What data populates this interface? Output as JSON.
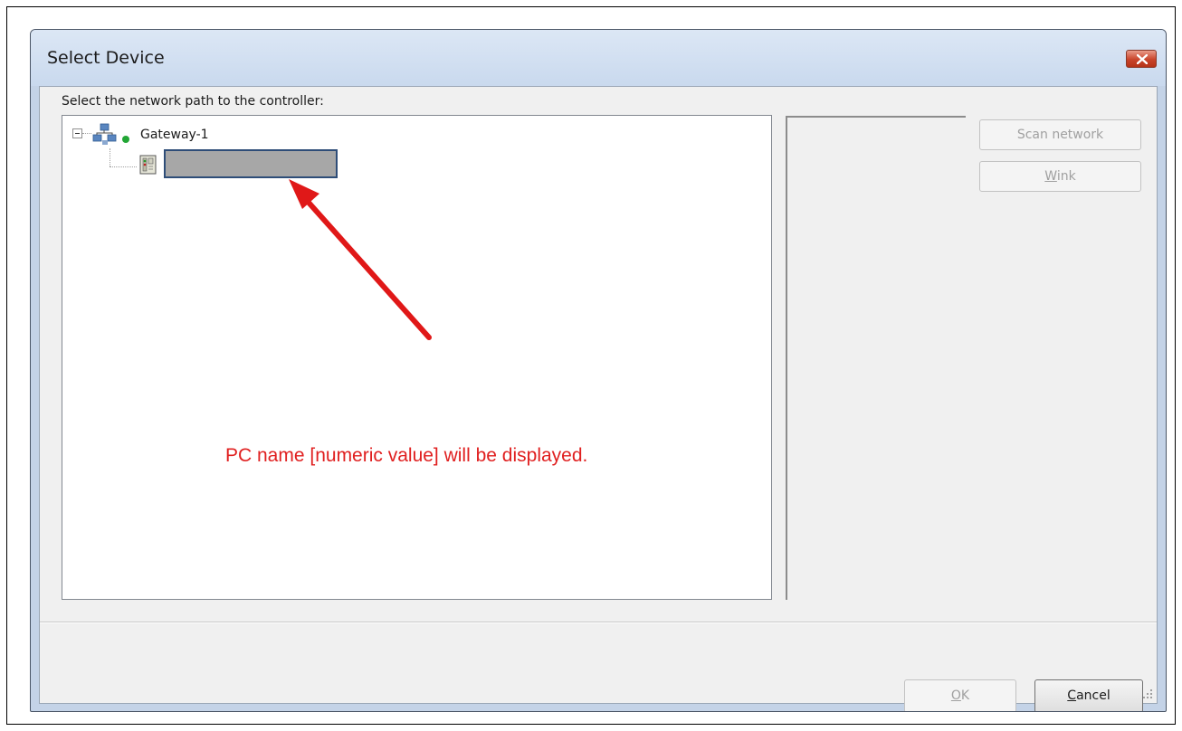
{
  "dialog": {
    "title": "Select Device",
    "prompt": "Select the network path to the controller:"
  },
  "tree": {
    "gateway": {
      "label": "Gateway-1",
      "status_color": "#22a635"
    },
    "device_name": ""
  },
  "annotation": {
    "text": "PC name [numeric value] will be displayed.",
    "color": "#e02020"
  },
  "buttons": {
    "scan_network": "Scan network",
    "wink_mnemonic": "W",
    "wink_rest": "ink",
    "ok_mnemonic": "O",
    "ok_rest": "K",
    "cancel_mnemonic": "C",
    "cancel_rest": "ancel"
  },
  "icons": {
    "close": "close-icon",
    "gateway": "network-gateway-icon",
    "device": "controller-device-icon",
    "expander": "collapse-icon",
    "grip": "resize-grip-icon"
  }
}
